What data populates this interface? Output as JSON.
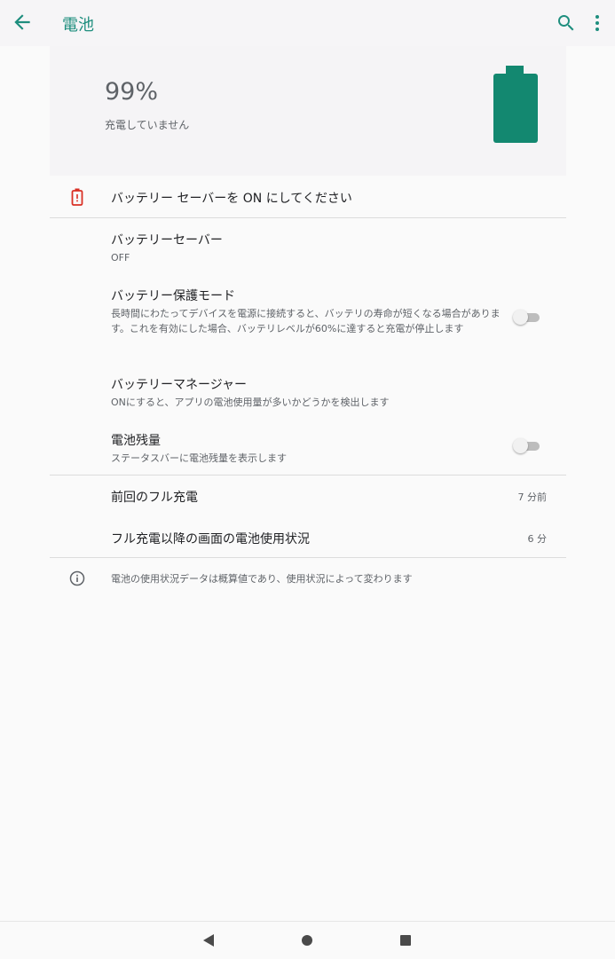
{
  "app_bar": {
    "title": "電池",
    "back_icon": "arrow-back-icon",
    "search_icon": "search-icon",
    "more_icon": "more-vert-icon",
    "accent_color": "#1e8e7e"
  },
  "battery_header": {
    "level": "99%",
    "status": "充電していません",
    "battery_fill_fraction": 0.99,
    "battery_color": "#138870"
  },
  "alert": {
    "icon": "battery-alert-icon",
    "text": "バッテリー セーバーを ON にしてください",
    "icon_color": "#d93025"
  },
  "preferences": [
    {
      "title": "バッテリーセーバー",
      "summary": "OFF"
    },
    {
      "title": "バッテリー保護モード",
      "summary": "長時間にわたってデバイスを電源に接続すると、バッテリの寿命が短くなる場合があります。これを有効にした場合、バッテリレベルが60%に達すると充電が停止します",
      "toggle": false
    },
    {
      "title": "バッテリーマネージャー",
      "summary": "ONにすると、アプリの電池使用量が多いかどうかを検出します"
    },
    {
      "title": "電池残量",
      "summary": "ステータスバーに電池残量を表示します",
      "toggle": false
    }
  ],
  "stats": [
    {
      "label": "前回のフル充電",
      "value": "7 分前"
    },
    {
      "label": "フル充電以降の画面の電池使用状況",
      "value": "6 分"
    }
  ],
  "footer_info": {
    "icon": "info-icon",
    "text": "電池の使用状況データは概算値であり、使用状況によって変わります"
  },
  "nav_bar": {
    "back": "nav-back-icon",
    "home": "nav-home-icon",
    "recents": "nav-recents-icon"
  }
}
